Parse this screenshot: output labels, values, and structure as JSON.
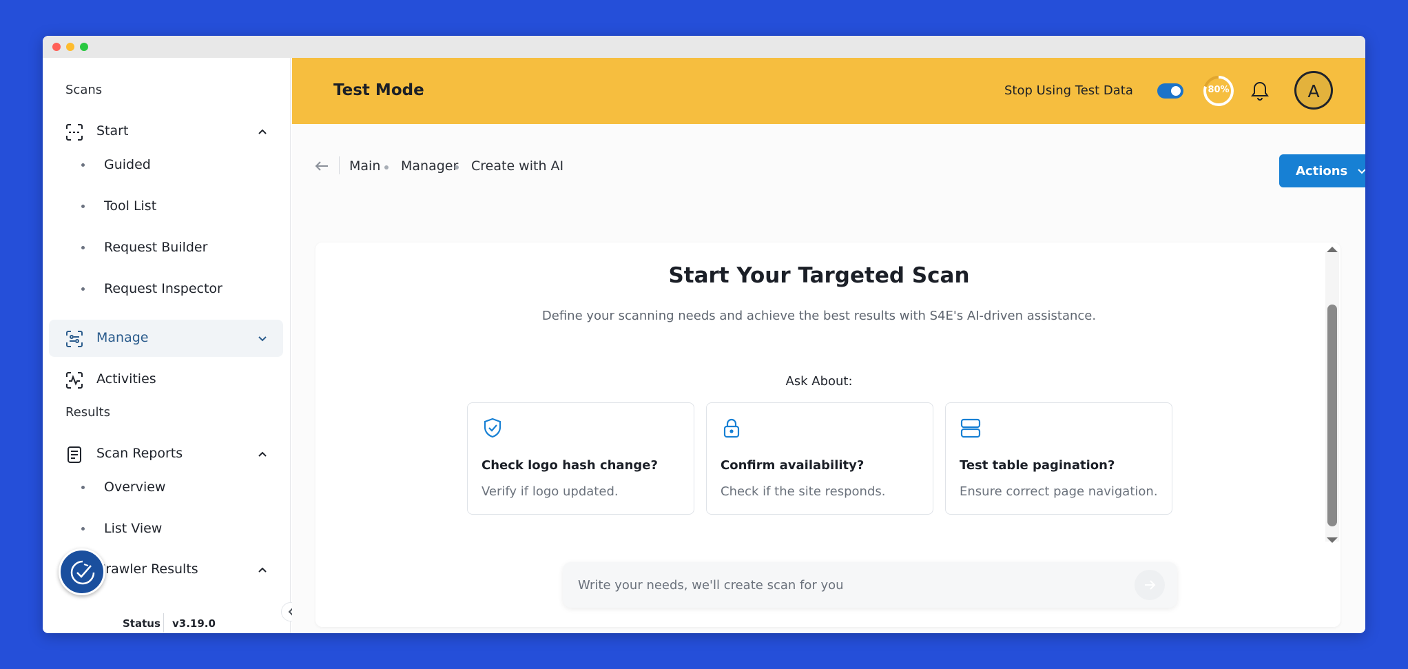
{
  "header": {
    "title": "Test Mode",
    "toggle_label": "Stop Using Test Data",
    "toggle_on": true,
    "progress_text": "80%",
    "progress_value": 0.8,
    "avatar_letter": "A",
    "bg_color": "#f6be3f"
  },
  "sidebar": {
    "sections": [
      {
        "label": "Scans"
      },
      {
        "label": "Results"
      }
    ],
    "items": [
      {
        "label": "Start",
        "icon": "scan-icon",
        "expanded": true,
        "sub": [
          "Guided",
          "Tool List",
          "Request Builder",
          "Request Inspector"
        ]
      },
      {
        "label": "Manage",
        "icon": "manage-icon",
        "active": true,
        "expanded": false
      },
      {
        "label": "Activities",
        "icon": "activity-icon"
      },
      {
        "label": "Scan Reports",
        "icon": "report-icon",
        "expanded": true,
        "sub": [
          "Overview",
          "List View"
        ]
      },
      {
        "label": "Crawler Results",
        "icon": "crawler-icon",
        "expanded": true
      }
    ],
    "footer": {
      "status_label": "Status",
      "version": "v3.19.0"
    }
  },
  "breadcrumb": {
    "items": [
      "Main",
      "Manager",
      "Create with AI"
    ]
  },
  "actions": {
    "label": "Actions"
  },
  "main": {
    "title": "Start Your Targeted Scan",
    "subtitle": "Define your scanning needs and achieve the best results with S4E's AI-driven assistance.",
    "ask_label": "Ask About:",
    "suggestions": [
      {
        "icon": "shield-check-icon",
        "title": "Check logo hash change?",
        "desc": "Verify if logo updated."
      },
      {
        "icon": "lock-icon",
        "title": "Confirm availability?",
        "desc": "Check if the site responds."
      },
      {
        "icon": "server-icon",
        "title": "Test table pagination?",
        "desc": "Ensure correct page navigation."
      }
    ]
  },
  "prompt": {
    "placeholder": "Write your needs, we'll create scan for you",
    "value": ""
  },
  "colors": {
    "accent": "#1780d4",
    "background": "#254fd9",
    "active_nav_text": "#2a5b8c"
  }
}
